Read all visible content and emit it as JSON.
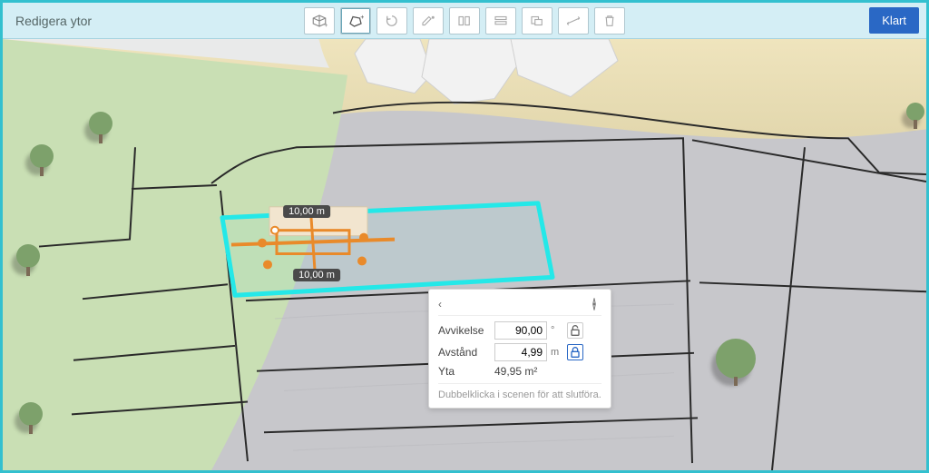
{
  "header": {
    "title": "Redigera ytor",
    "done_label": "Klart"
  },
  "toolbar": {
    "buttons": [
      {
        "name": "add-shape-tool",
        "icon": "cube-plus"
      },
      {
        "name": "freehand-tool",
        "icon": "polygon-plus"
      },
      {
        "name": "rotate-tool",
        "icon": "rotate"
      },
      {
        "name": "edit-vertex-tool",
        "icon": "edit-pencil"
      },
      {
        "name": "align-tool",
        "icon": "align-panels"
      },
      {
        "name": "distribute-tool",
        "icon": "stack"
      },
      {
        "name": "duplicate-tool",
        "icon": "overlap"
      },
      {
        "name": "measure-tool",
        "icon": "dimension"
      },
      {
        "name": "delete-tool",
        "icon": "trash"
      }
    ],
    "active_index": 1
  },
  "measurements": {
    "top_label": "10,00 m",
    "bottom_label": "10,00 m"
  },
  "panel": {
    "deviation_label": "Avvikelse",
    "deviation_value": "90,00",
    "deviation_unit": "°",
    "distance_label": "Avstånd",
    "distance_value": "4,99",
    "distance_unit": "m",
    "area_label": "Yta",
    "area_value": "49,95 m²",
    "hint": "Dubbelklicka i scenen för att slutföra."
  },
  "colors": {
    "selection": "#24e8e8",
    "gizmo": "#e98a2a",
    "terrain_green": "#c9dfb4",
    "terrain_grey": "#c7c7cb",
    "terrain_sand": "#e7ddb9"
  }
}
